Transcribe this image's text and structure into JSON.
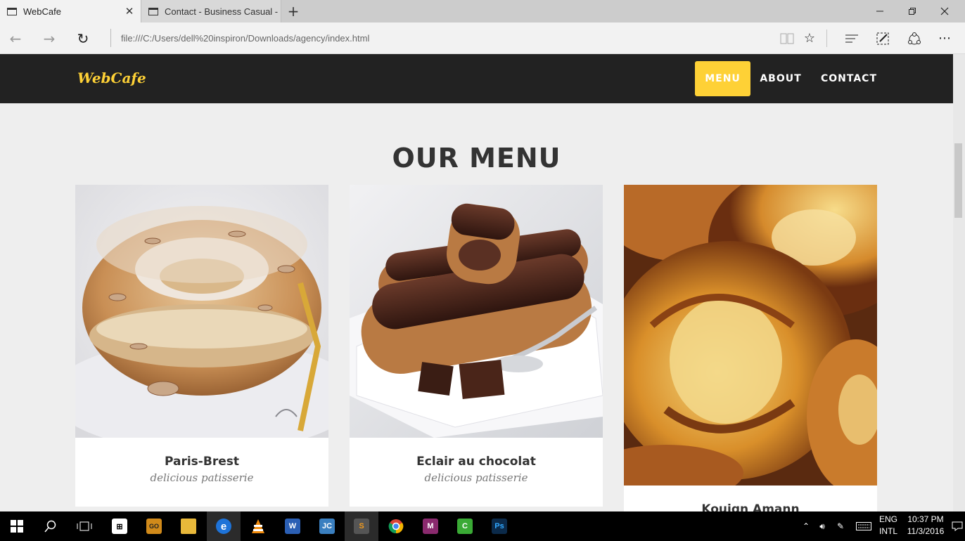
{
  "browser": {
    "tabs": [
      {
        "title": "WebCafe",
        "active": true
      },
      {
        "title": "Contact - Business Casual -",
        "active": false
      }
    ],
    "address": "file:///C:/Users/dell%20inspiron/Downloads/agency/index.html"
  },
  "site": {
    "brand": "WebCafe",
    "nav": [
      {
        "label": "MENU",
        "active": true
      },
      {
        "label": "ABOUT",
        "active": false
      },
      {
        "label": "CONTACT",
        "active": false
      }
    ],
    "heading": "OUR MENU",
    "items": [
      {
        "name": "Paris-Brest",
        "subtitle": "delicious patisserie"
      },
      {
        "name": "Eclair au chocolat",
        "subtitle": "delicious patisserie"
      },
      {
        "name": "Kouign Amann",
        "subtitle": ""
      }
    ]
  },
  "colors": {
    "accent": "#fed136",
    "navbar": "#222222",
    "page_bg": "#eeeeee"
  },
  "taskbar": {
    "apps": [
      "start-icon",
      "search-icon",
      "task-view-icon",
      "store-icon",
      "csgo-icon",
      "file-explorer-icon",
      "edge-icon",
      "vlc-icon",
      "word-icon",
      "jc-icon",
      "sublime-icon",
      "chrome-icon",
      "m-icon",
      "camtasia-icon",
      "photoshop-icon"
    ],
    "lang_top": "ENG",
    "lang_bottom": "INTL",
    "time": "10:37 PM",
    "date": "11/3/2016"
  }
}
